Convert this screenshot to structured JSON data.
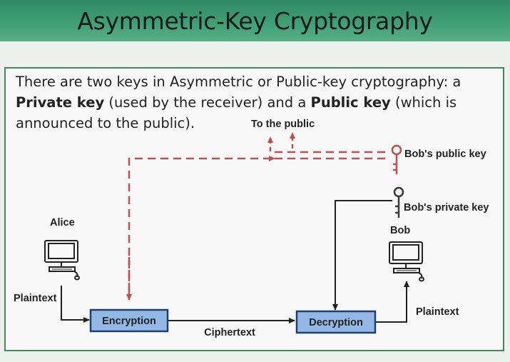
{
  "title": "Asymmetric-Key Cryptography",
  "intro": {
    "part1": "There are two keys in Asymmetric or Public-key cryptography: a ",
    "bold1": "Private key",
    "part2": " (used by the receiver) and a ",
    "bold2": "Public key",
    "part3": " (which is announced to the public)."
  },
  "diagram": {
    "to_public": "To the public",
    "bob_public_key": "Bob's public key",
    "bob_private_key": "Bob's private key",
    "alice": "Alice",
    "bob": "Bob",
    "plaintext_left": "Plaintext",
    "plaintext_right": "Plaintext",
    "encryption": "Encryption",
    "decryption": "Decryption",
    "ciphertext": "Ciphertext"
  },
  "colors": {
    "public_key": "#c0504d",
    "private_key": "#3a3a3a",
    "box_fill": "#93b8e6",
    "box_border": "#1f3f6e"
  }
}
